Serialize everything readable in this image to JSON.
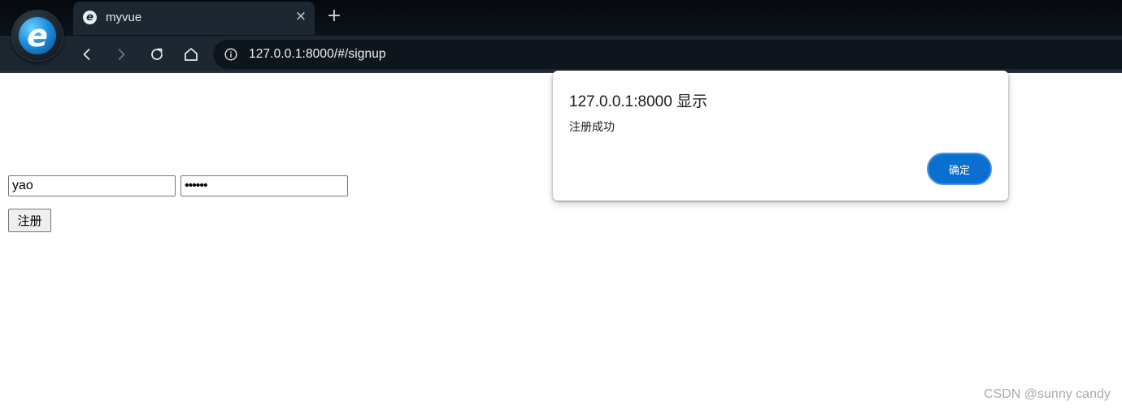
{
  "browser": {
    "tab": {
      "title": "myvue",
      "close_glyph": "×",
      "favicon_glyph": "e"
    },
    "new_tab_glyph": "+",
    "logo_glyph": "e",
    "address_bar": {
      "url": "127.0.0.1:8000/#/signup"
    },
    "icons": {
      "back": "back-arrow-icon",
      "forward": "forward-arrow-icon",
      "reload": "reload-icon",
      "home": "home-icon",
      "site_info": "info-icon"
    }
  },
  "form": {
    "username_value": "yao",
    "password_value": "••••••",
    "submit_label": "注册"
  },
  "alert": {
    "title": "127.0.0.1:8000 显示",
    "message": "注册成功",
    "ok_label": "确定",
    "ok_color": "#0b6fd0"
  },
  "watermark": "CSDN @sunny candy"
}
